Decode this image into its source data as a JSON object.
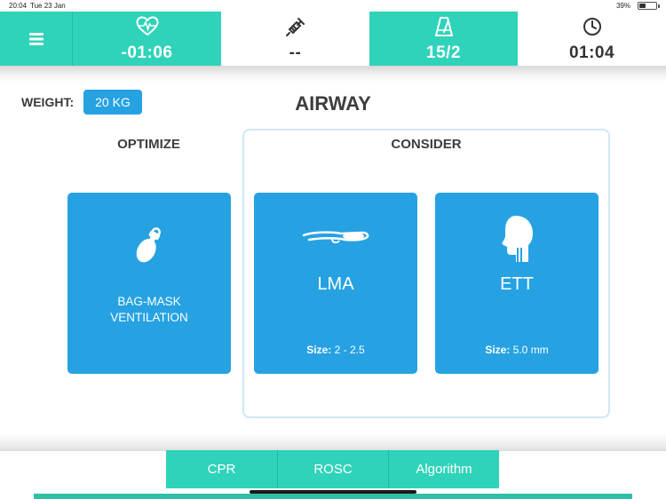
{
  "status_bar": {
    "time": "20:04",
    "date": "Tue 23 Jan",
    "battery_text": "39%",
    "battery_level": 0.39
  },
  "top_bar": {
    "menu_icon": "hamburger-menu-icon",
    "stats": [
      {
        "icon": "heart-rate-icon",
        "value": "-01:06",
        "style": "teal"
      },
      {
        "icon": "syringe-icon",
        "value": "--",
        "style": "white"
      },
      {
        "icon": "metronome-icon",
        "value": "15/2",
        "style": "teal"
      },
      {
        "icon": "clock-icon",
        "value": "01:04",
        "style": "white"
      }
    ]
  },
  "header": {
    "weight_label": "WEIGHT:",
    "weight_value": "20 KG",
    "title": "AIRWAY"
  },
  "sections": {
    "optimize_label": "OPTIMIZE",
    "consider_label": "CONSIDER"
  },
  "cards": {
    "bag_mask": {
      "icon": "bag-mask-icon",
      "label_line1": "BAG-MASK",
      "label_line2": "VENTILATION"
    },
    "lma": {
      "icon": "lma-airway-icon",
      "label": "LMA",
      "size_label": "Size:",
      "size_value": "2 - 2.5"
    },
    "ett": {
      "icon": "head-profile-icon",
      "label": "ETT",
      "size_label": "Size:",
      "size_value": "5.0 mm"
    }
  },
  "bottom_nav": {
    "cpr": "CPR",
    "rosc": "ROSC",
    "algorithm": "Algorithm"
  },
  "colors": {
    "teal": "#2fd3b9",
    "blue": "#26a2e3",
    "consider_border": "#cfe8f7",
    "text_dark": "#3d3d3d"
  }
}
